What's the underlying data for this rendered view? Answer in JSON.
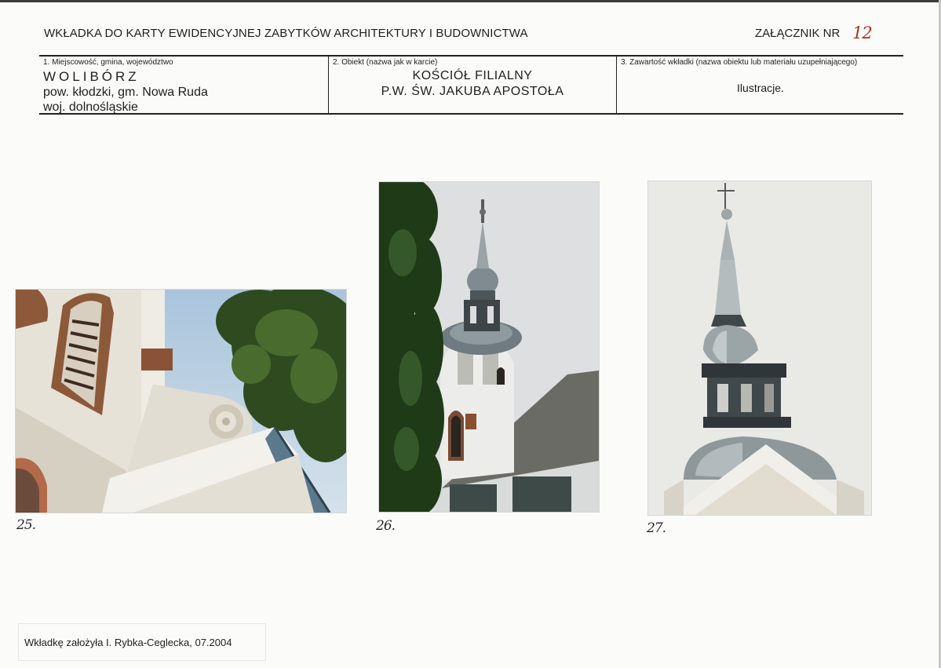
{
  "header": {
    "title": "WKŁADKA DO KARTY EWIDENCYJNEJ ZABYTKÓW ARCHITEKTURY I BUDOWNICTWA",
    "annex_label": "ZAŁĄCZNIK NR",
    "annex_number": "12"
  },
  "info": {
    "col1": {
      "label": "1. Miejscowość, gmina, województwo",
      "place": "WOLIBÓRZ",
      "line2": "pow. kłodzki, gm. Nowa Ruda",
      "line3": "woj. dolnośląskie"
    },
    "col2": {
      "label": "2. Obiekt (nazwa jak w karcie)",
      "line1": "KOŚCIÓŁ FILIALNY",
      "line2": "P.W. ŚW. JAKUBA APOSTOŁA"
    },
    "col3": {
      "label": "3. Zawartość wkładki (nazwa obiektu lub materiału uzupełniającego)",
      "content": "Ilustracje."
    }
  },
  "photos": [
    {
      "number": "25."
    },
    {
      "number": "26."
    },
    {
      "number": "27."
    }
  ],
  "footer": {
    "text": "Wkładkę założyła I. Rybka-Ceglecka, 07.2004"
  }
}
